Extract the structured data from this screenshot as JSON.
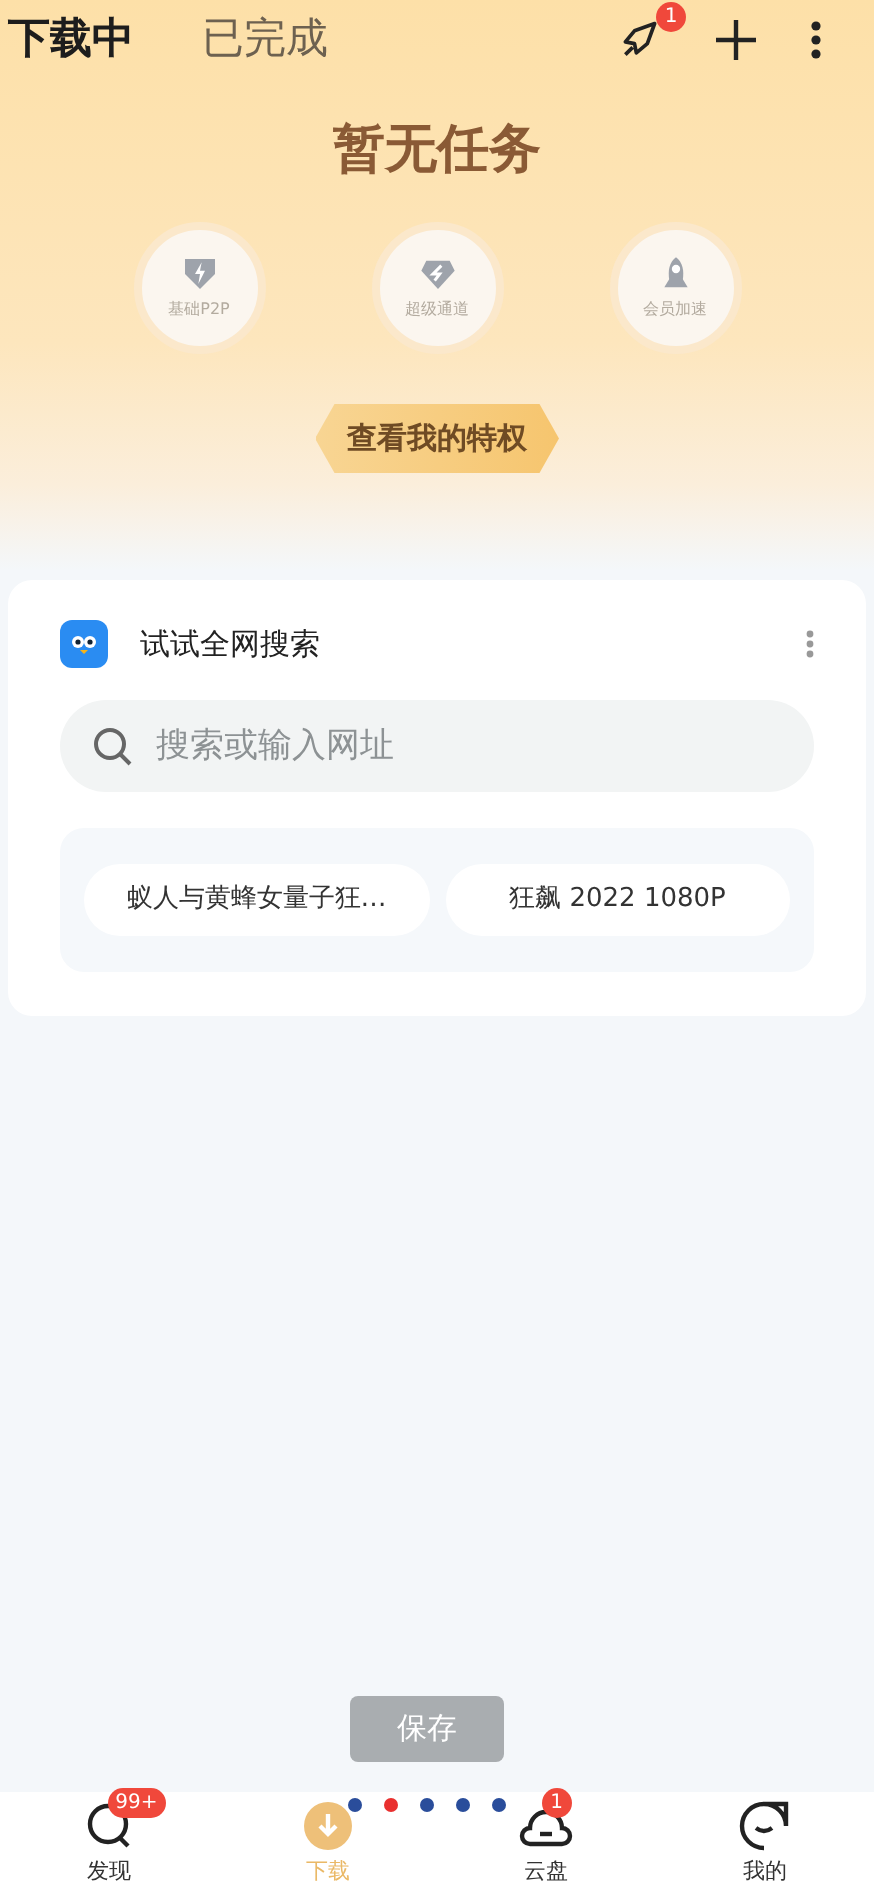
{
  "tabs": [
    {
      "label": "下载中",
      "selected": true
    },
    {
      "label": "已完成",
      "selected": false
    }
  ],
  "header_actions": {
    "rocket_badge": "1"
  },
  "empty_title": "暂无任务",
  "features": [
    {
      "label": "基础P2P",
      "kind": "shield"
    },
    {
      "label": "超级通道",
      "kind": "diamond"
    },
    {
      "label": "会员加速",
      "kind": "rocket"
    }
  ],
  "privilege_button": "查看我的特权",
  "search_card": {
    "title": "试试全网搜索",
    "placeholder": "搜索或输入网址",
    "suggestions": [
      "蚁人与黄蜂女量子狂…",
      "狂飙 2022 1080P"
    ]
  },
  "save_button": {
    "label": "保存",
    "disabled": true
  },
  "pager_dots": [
    {
      "selected": false
    },
    {
      "selected": true
    },
    {
      "selected": false
    },
    {
      "selected": false
    },
    {
      "selected": false
    }
  ],
  "bottom_nav": [
    {
      "label": "发现",
      "kind": "discover",
      "badge": "99+",
      "selected": false
    },
    {
      "label": "下载",
      "kind": "download",
      "selected": true
    },
    {
      "label": "云盘",
      "kind": "cloud",
      "badge": "1",
      "selected": false
    },
    {
      "label": "我的",
      "kind": "me",
      "selected": false
    }
  ]
}
